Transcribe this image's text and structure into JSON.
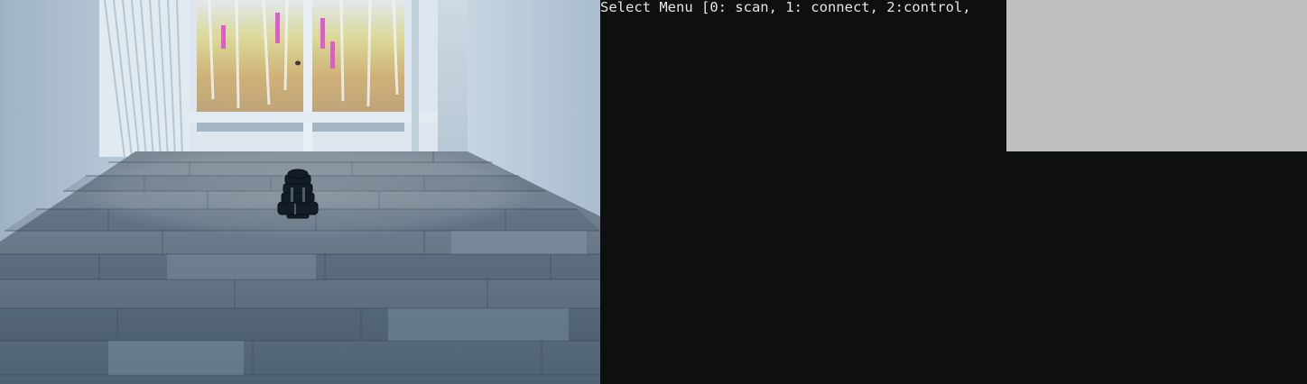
{
  "terminal": {
    "prompt_line": "Select Menu [0: scan, 1: connect, 2:control,"
  },
  "colors": {
    "terminal_background": "#0e1010",
    "terminal_text": "#e4e4e4",
    "overlay_background": "#bfbfbf"
  }
}
